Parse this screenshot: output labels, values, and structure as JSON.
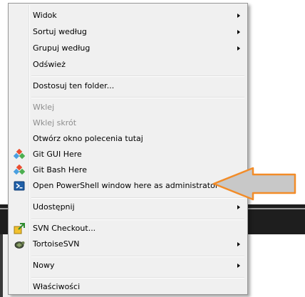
{
  "menu": {
    "items": [
      {
        "label": "Widok",
        "submenu": true,
        "disabled": false
      },
      {
        "label": "Sortuj według",
        "submenu": true,
        "disabled": false
      },
      {
        "label": "Grupuj według",
        "submenu": true,
        "disabled": false
      },
      {
        "label": "Odśwież",
        "submenu": false,
        "disabled": false
      },
      {
        "label": "Dostosuj ten folder...",
        "submenu": false,
        "disabled": false
      },
      {
        "label": "Wklej",
        "submenu": false,
        "disabled": true
      },
      {
        "label": "Wklej skrót",
        "submenu": false,
        "disabled": true
      },
      {
        "label": "Otwórz okno polecenia tutaj",
        "submenu": false,
        "disabled": false
      },
      {
        "label": "Git GUI Here",
        "submenu": false,
        "disabled": false,
        "icon": "git-gui-icon"
      },
      {
        "label": "Git Bash Here",
        "submenu": false,
        "disabled": false,
        "icon": "git-bash-icon"
      },
      {
        "label": "Open PowerShell window here as administrator",
        "submenu": false,
        "disabled": false,
        "icon": "powershell-icon"
      },
      {
        "label": "Udostępnij",
        "submenu": true,
        "disabled": false
      },
      {
        "label": "SVN Checkout...",
        "submenu": false,
        "disabled": false,
        "icon": "svn-checkout-icon"
      },
      {
        "label": "TortoiseSVN",
        "submenu": true,
        "disabled": false,
        "icon": "tortoisesvn-icon"
      },
      {
        "label": "Nowy",
        "submenu": true,
        "disabled": false
      },
      {
        "label": "Właściwości",
        "submenu": false,
        "disabled": false
      }
    ]
  },
  "annotation": {
    "color": "#f28c28",
    "fill": "#c8c8c8"
  },
  "colors": {
    "menu_bg": "#f0f0f0",
    "disabled_text": "#8e8e8e"
  }
}
